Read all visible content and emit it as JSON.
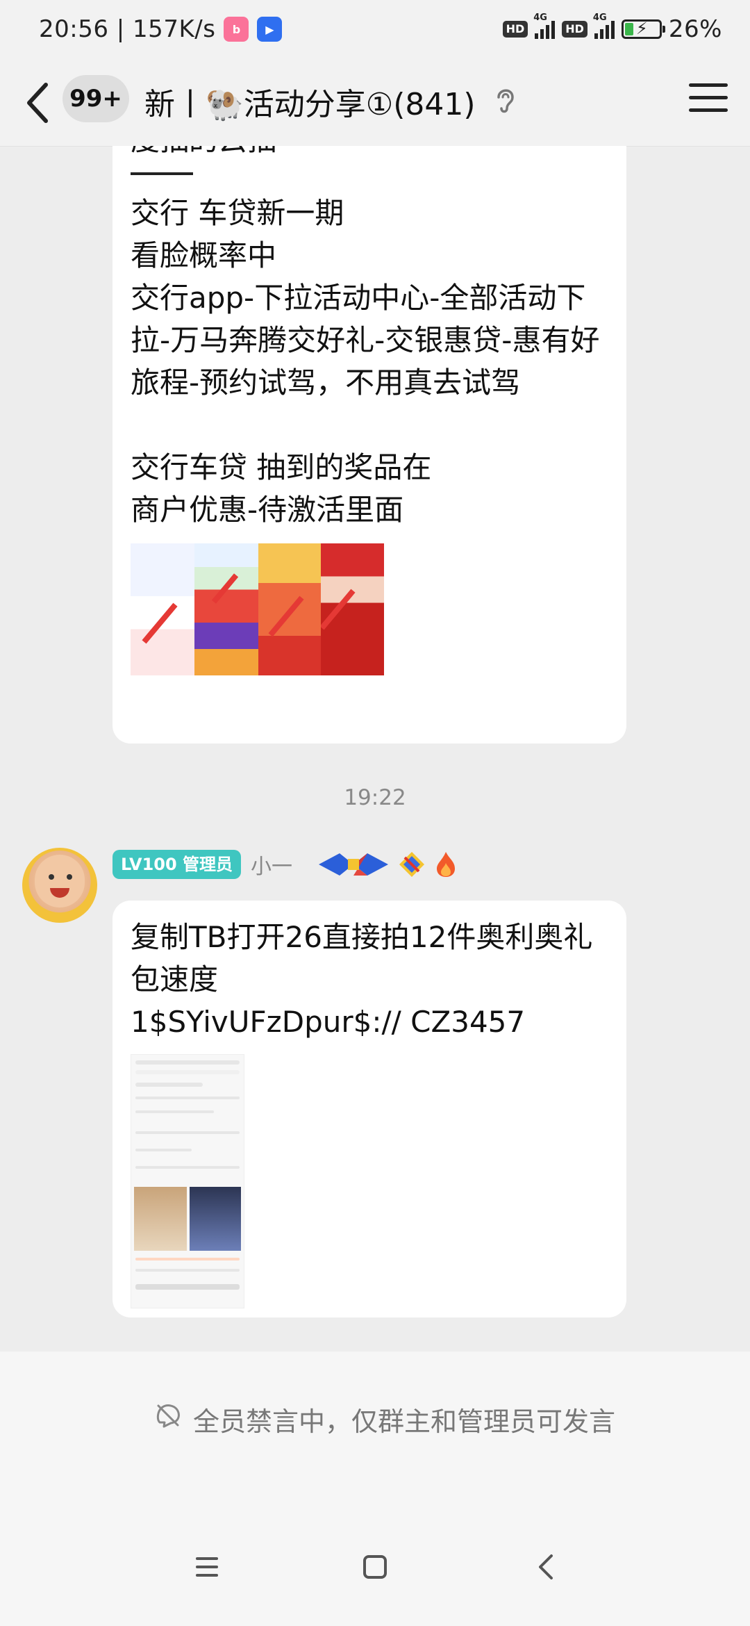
{
  "status_bar": {
    "time_speed": "20:56 | 157K/s",
    "battery_text": "26%",
    "hd_label": "HD",
    "network_label": "4G",
    "battery_level": 0.26
  },
  "header": {
    "unread_count": "99+",
    "title": "新丨🐏活动分享①(841)"
  },
  "messages": [
    {
      "cut_text": "度抽的云抽",
      "text": "交行 车贷新一期\n看脸概率中\n交行app-下拉活动中心-全部活动下拉-万马奔腾交好礼-交银惠贷-惠有好旅程-预约试驾，不用真去试驾\n\n交行车贷 抽到的奖品在\n商户优惠-待激活里面"
    },
    {
      "time": "19:22",
      "role_badge": "LV100 管理员",
      "sender": "小一",
      "text": "复制TB打开26直接拍12件奥利奥礼包速度\n1$SYivUFzDpur$:// CZ3457"
    }
  ],
  "footer": {
    "notice": "全员禁言中，仅群主和管理员可发言"
  },
  "icons": {
    "back": "chevron-left-icon",
    "menu": "hamburger-menu-icon",
    "ear": "ear-icon",
    "mute": "mute-icon"
  },
  "colors": {
    "accent_badge": "#3fc6c0",
    "bubble": "#ffffff",
    "background": "#ededed"
  }
}
